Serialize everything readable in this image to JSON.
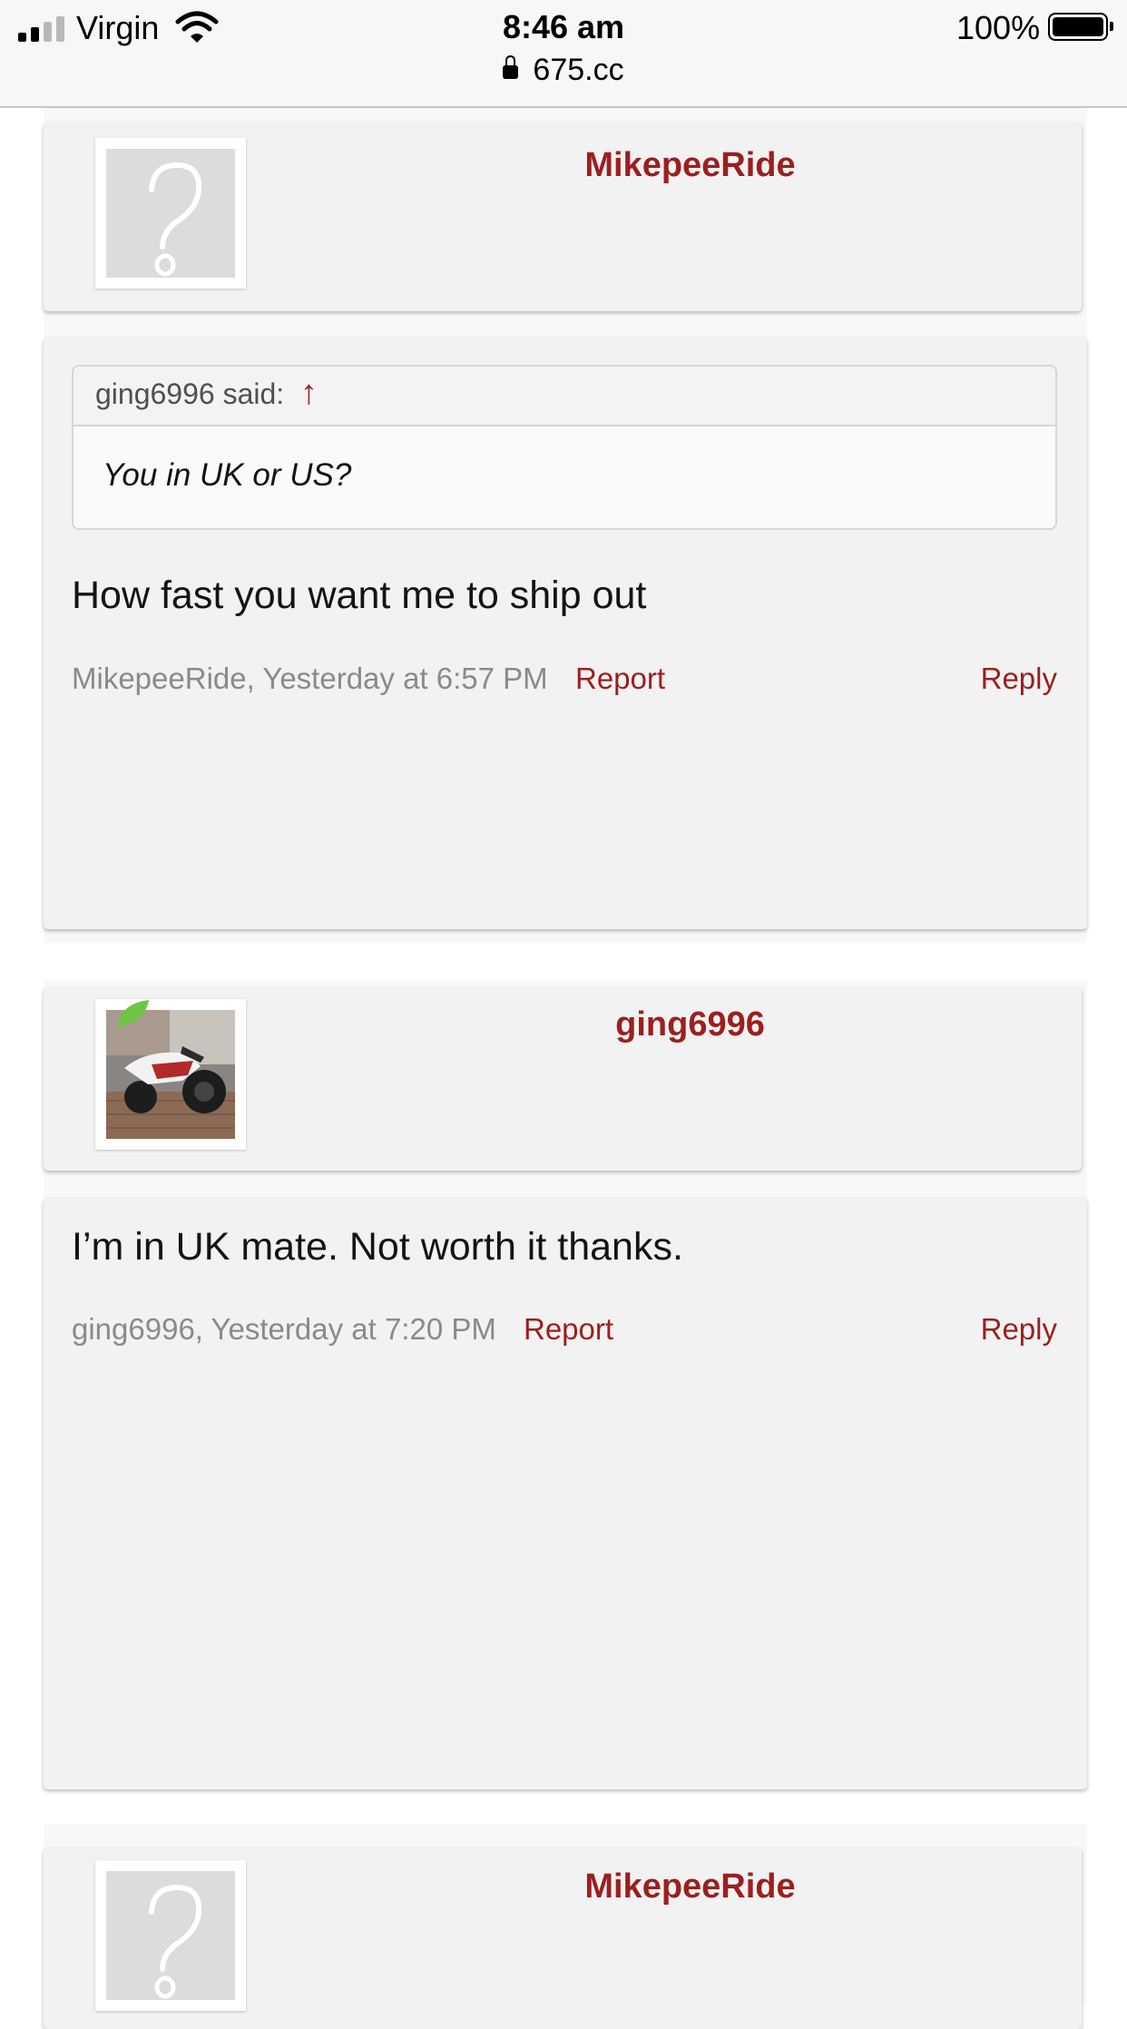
{
  "status_bar": {
    "carrier": "Virgin",
    "time": "8:46 am",
    "url": "675.cc",
    "battery": "100%",
    "icons": [
      "signal-icon",
      "wifi-icon",
      "lock-icon",
      "battery-icon"
    ]
  },
  "posts": [
    {
      "username": "MikepeeRide",
      "avatar": "default-question-avatar",
      "quote": {
        "attribution": "ging6996 said:",
        "arrow": "↑",
        "text": "You in UK or US?"
      },
      "message": "How fast you want me to ship out",
      "meta": "MikepeeRide, Yesterday at 6:57 PM",
      "report_label": "Report",
      "reply_label": "Reply"
    },
    {
      "username": "ging6996",
      "avatar": "motorcycle-photo-avatar",
      "message": "I’m in UK mate. Not worth it thanks.",
      "meta": "ging6996, Yesterday at 7:20 PM",
      "report_label": "Report",
      "reply_label": "Reply"
    },
    {
      "username": "MikepeeRide",
      "avatar": "default-question-avatar"
    }
  ],
  "colors": {
    "accent": "#9c1f1f",
    "card_bg": "#f2f2f2",
    "meta_text": "#8a8a8a",
    "online_badge": "#6cc644"
  }
}
